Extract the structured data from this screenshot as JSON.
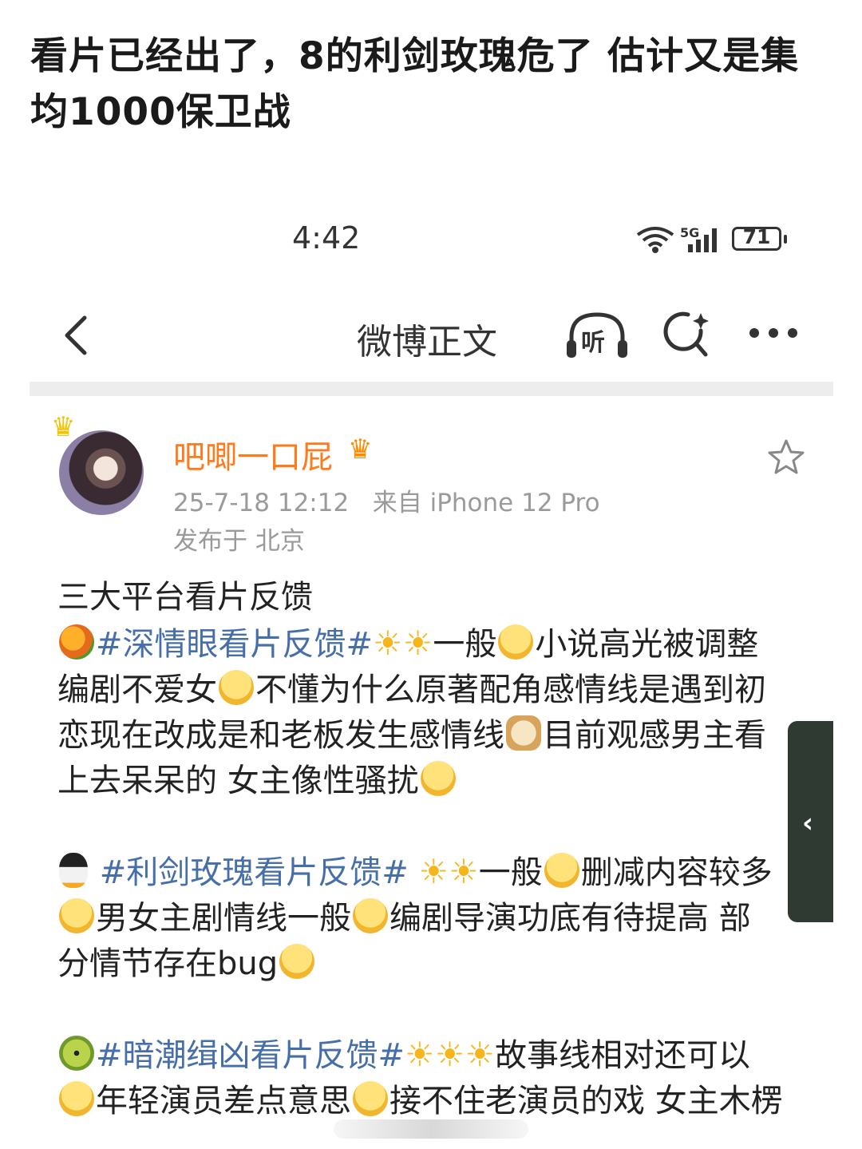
{
  "caption": "看片已经出了，8的利剑玫瑰危了 估计又是集均1000保卫战",
  "status_bar": {
    "time": "4:42",
    "network": "5G",
    "battery": "71"
  },
  "nav": {
    "title": "微博正文",
    "listen_label": "听"
  },
  "post": {
    "username": "吧唧一口屁",
    "timestamp": "25-7-18 12:12",
    "source": "来自 iPhone 12 Pro",
    "location": "发布于 北京",
    "line1": "三大平台看片反馈",
    "b1": {
      "tag": "#深情眼看片反馈#",
      "rating": "一般",
      "l1_after": "小说高光被调整",
      "l2_a": "编剧不爱女",
      "l2_b": "不懂为什么原著配角感情线是遇到初",
      "l3_a": "恋现在改成是和老板发生感情线",
      "l3_b": "目前观感男主看",
      "l4": "上去呆呆的 女主像性骚扰"
    },
    "b2": {
      "tag": "#利剑玫瑰看片反馈#",
      "rating": "一般",
      "l1_after": "删减内容较多",
      "l2_a": "男女主剧情线一般",
      "l2_b": "编剧导演功底有待提高 部",
      "l3": "分情节存在bug"
    },
    "b3": {
      "tag": "#暗潮缉凶看片反馈#",
      "l1_after": "故事线相对还可以",
      "l2_a": "年轻演员差点意思",
      "l2_b": "接不住老演员的戏 女主木楞"
    }
  },
  "icons": {
    "star": "☀",
    "back": "chevron-left-icon",
    "listen": "headphones-icon",
    "search": "search-icon",
    "more": "more-icon",
    "favorite": "star-outline-icon"
  },
  "colors": {
    "username": "#ff7a1a",
    "hashtag": "#466ea8",
    "meta": "#9a9a9a"
  }
}
